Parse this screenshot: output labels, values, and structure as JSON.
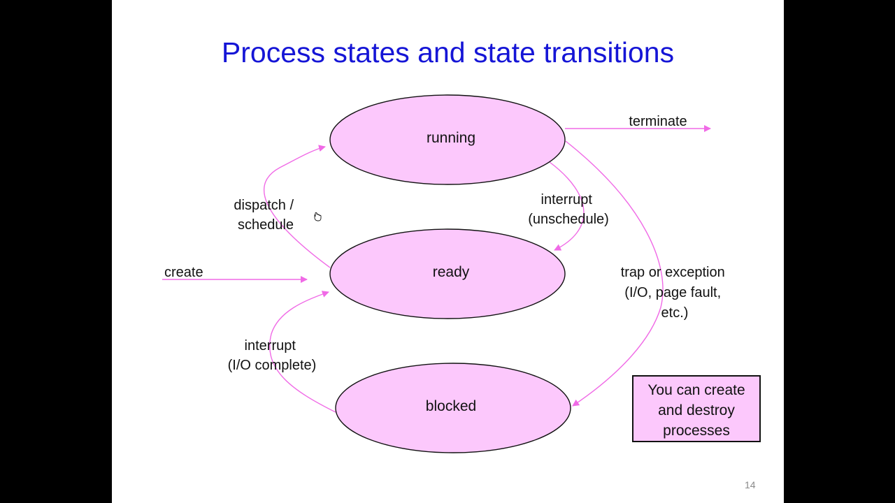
{
  "slide": {
    "title": "Process states and state transitions",
    "page_number": "14",
    "colors": {
      "title": "#1515d6",
      "state_fill": "#fcc8fc",
      "arrow": "#f06ae6",
      "background": "#ffffff",
      "frame": "#000000"
    }
  },
  "states": {
    "running": "running",
    "ready": "ready",
    "blocked": "blocked"
  },
  "transitions": {
    "terminate": "terminate",
    "dispatch": [
      "dispatch /",
      "schedule"
    ],
    "interrupt_unschedule": [
      "interrupt",
      "(unschedule)"
    ],
    "create": "create",
    "trap": [
      "trap or exception",
      "(I/O, page fault,",
      "etc.)"
    ],
    "interrupt_io": [
      "interrupt",
      "(I/O complete)"
    ]
  },
  "note": {
    "lines": [
      "You can create",
      "and destroy",
      "processes"
    ]
  }
}
